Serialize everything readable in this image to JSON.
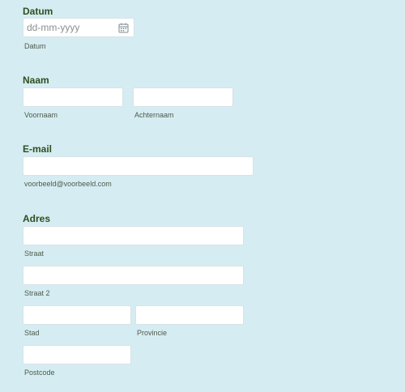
{
  "date": {
    "title": "Datum",
    "placeholder": "dd-mm-yyyy",
    "sublabel": "Datum",
    "icon": "calendar-icon"
  },
  "name": {
    "title": "Naam",
    "first_label": "Voornaam",
    "last_label": "Achternaam"
  },
  "email": {
    "title": "E-mail",
    "sublabel": "voorbeeld@voorbeeld.com"
  },
  "address": {
    "title": "Adres",
    "street_label": "Straat",
    "street2_label": "Straat 2",
    "city_label": "Stad",
    "province_label": "Provincie",
    "postcode_label": "Postcode"
  },
  "colors": {
    "background": "#d5ecf2",
    "section_title": "#2f4f1f",
    "input_bg": "#ffffff"
  }
}
